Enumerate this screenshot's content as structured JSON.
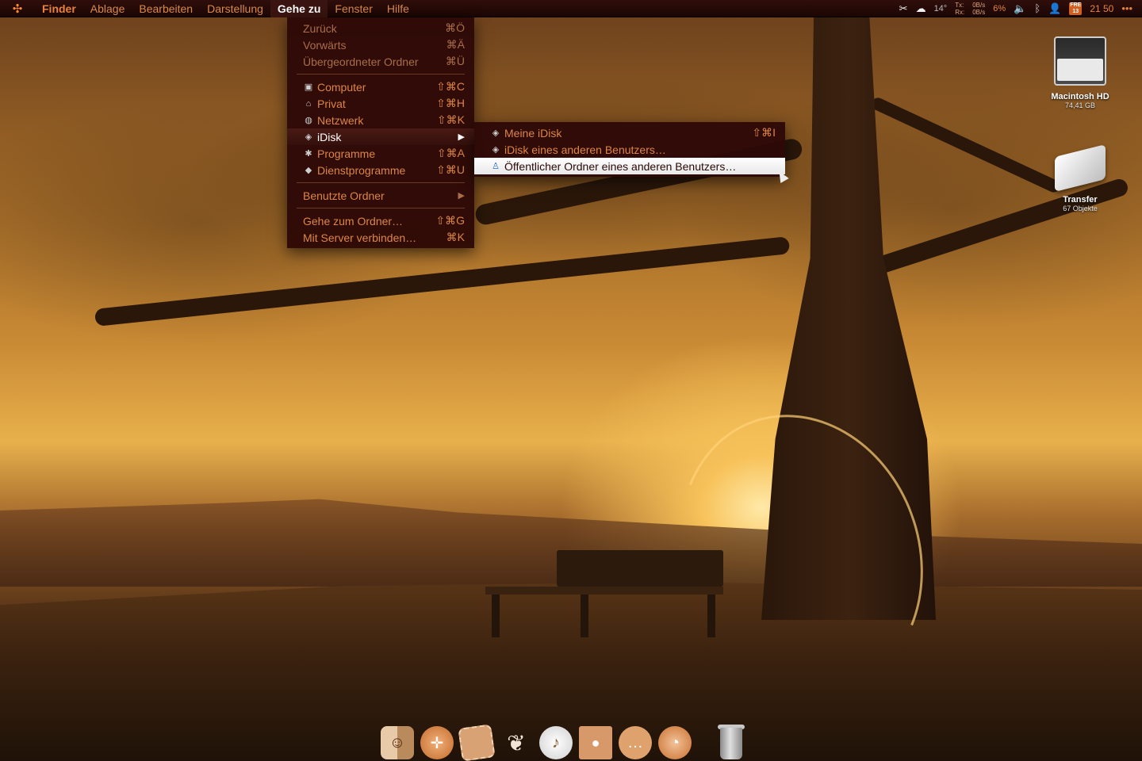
{
  "menubar": {
    "app": "Finder",
    "menus": [
      "Ablage",
      "Bearbeiten",
      "Darstellung",
      "Gehe zu",
      "Fenster",
      "Hilfe"
    ],
    "status": {
      "temp": "14°",
      "tx_label": "Tx:",
      "rx_label": "Rx:",
      "tx_value": "0B/s",
      "rx_value": "0B/s",
      "cpu": "6%",
      "calendar_day": "FRE",
      "calendar_date": "13",
      "clock": "21 50"
    }
  },
  "go_menu": {
    "items": [
      {
        "label": "Zurück",
        "shortcut": "⌘Ö"
      },
      {
        "label": "Vorwärts",
        "shortcut": "⌘Ä"
      },
      {
        "label": "Übergeordneter Ordner",
        "shortcut": "⌘Ü"
      },
      {
        "label": "Computer",
        "shortcut": "⇧⌘C"
      },
      {
        "label": "Privat",
        "shortcut": "⇧⌘H"
      },
      {
        "label": "Netzwerk",
        "shortcut": "⇧⌘K"
      },
      {
        "label": "iDisk",
        "shortcut": ""
      },
      {
        "label": "Programme",
        "shortcut": "⇧⌘A"
      },
      {
        "label": "Dienstprogramme",
        "shortcut": "⇧⌘U"
      },
      {
        "label": "Benutzte Ordner",
        "shortcut": ""
      },
      {
        "label": "Gehe zum Ordner…",
        "shortcut": "⇧⌘G"
      },
      {
        "label": "Mit Server verbinden…",
        "shortcut": "⌘K"
      }
    ]
  },
  "idisk_submenu": {
    "items": [
      {
        "label": "Meine iDisk",
        "shortcut": "⇧⌘I"
      },
      {
        "label": "iDisk eines anderen Benutzers…",
        "shortcut": ""
      },
      {
        "label": "Öffentlicher Ordner eines anderen Benutzers…",
        "shortcut": ""
      }
    ]
  },
  "desktop": {
    "icons": [
      {
        "label": "Macintosh HD",
        "sub": "74,41 GB"
      },
      {
        "label": "Transfer",
        "sub": "67 Objekte"
      }
    ]
  },
  "colors": {
    "menu_text": "#dc8646",
    "menu_bg": "#2d0806",
    "accent": "#e8823a"
  }
}
